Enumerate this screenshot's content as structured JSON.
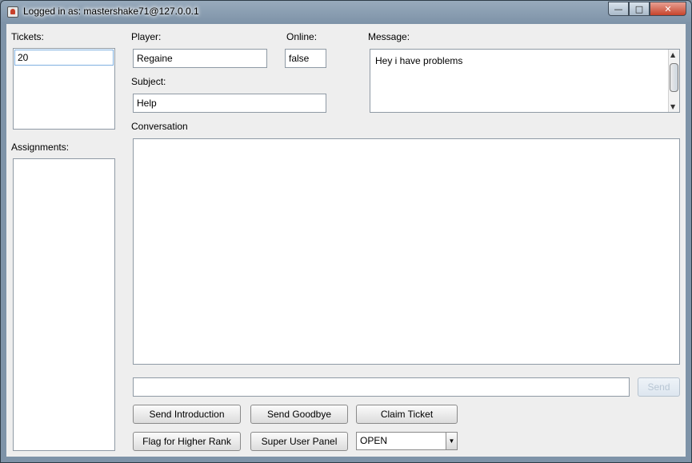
{
  "window": {
    "title": "Logged in as: mastershake71@127.0.0.1",
    "minimize_glyph": "—",
    "maximize_glyph": "□",
    "close_glyph": "✕"
  },
  "tickets": {
    "label": "Tickets:",
    "items": [
      "20"
    ]
  },
  "assignments": {
    "label": "Assignments:"
  },
  "player": {
    "label": "Player:",
    "value": "Regaine"
  },
  "online": {
    "label": "Online:",
    "value": "false"
  },
  "subject": {
    "label": "Subject:",
    "value": "Help"
  },
  "message": {
    "label": "Message:",
    "value": "Hey i have problems"
  },
  "conversation": {
    "label": "Conversation",
    "chat_input_value": "",
    "send_label": "Send"
  },
  "actions": {
    "send_introduction": "Send Introduction",
    "send_goodbye": "Send Goodbye",
    "claim_ticket": "Claim Ticket",
    "flag_higher_rank": "Flag for Higher Rank",
    "super_user_panel": "Super User Panel",
    "status_selected": "OPEN"
  }
}
